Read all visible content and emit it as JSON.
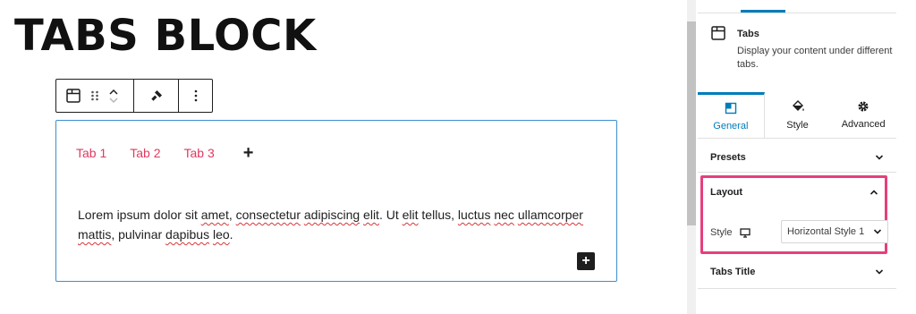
{
  "canvas": {
    "page_title": "TABS BLOCK",
    "toolbar": {
      "block_icon": "tabs-block-icon",
      "drag_icon": "drag-handle-icon",
      "move_up_icon": "chevron-up-icon",
      "move_down_icon": "chevron-down-icon",
      "style_icon": "paint-brush-icon",
      "more_icon": "more-options-icon"
    },
    "tabs_block": {
      "tabs": [
        {
          "label": "Tab 1"
        },
        {
          "label": "Tab 2"
        },
        {
          "label": "Tab 3"
        }
      ],
      "add_tab_label": "+",
      "content": {
        "t1": "Lorem ipsum dolor sit ",
        "w_amet": "amet",
        "t2": ", ",
        "w_consectetur": "consectetur",
        "t3": " ",
        "w_adipiscing": "adipiscing",
        "t4": " ",
        "w_elit1": "elit",
        "t5": ". Ut ",
        "w_elit2": "elit",
        "t6": " tellus, ",
        "w_luctus": "luctus",
        "t7": " ",
        "w_nec": "nec",
        "t8": " ",
        "w_ullamcorper": "ullamcorper",
        "t9": " ",
        "w_mattis": "mattis",
        "t10": ", pulvinar ",
        "w_dapibus": "dapibus",
        "t11": " ",
        "w_leo": "leo",
        "t12": "."
      },
      "inserter_label": "+"
    }
  },
  "sidebar": {
    "block_card": {
      "icon": "tabs-block-icon",
      "title": "Tabs",
      "description": "Display your content under different tabs."
    },
    "panel_tabs": [
      {
        "label": "General",
        "icon": "general-icon",
        "active": true
      },
      {
        "label": "Style",
        "icon": "paint-bucket-icon",
        "active": false
      },
      {
        "label": "Advanced",
        "icon": "gear-icon",
        "active": false
      }
    ],
    "presets": {
      "label": "Presets",
      "expanded": false
    },
    "layout": {
      "label": "Layout",
      "expanded": true,
      "style_label": "Style",
      "device_icon": "desktop-icon",
      "style_value": "Horizontal Style 1"
    },
    "tabs_title": {
      "label": "Tabs Title",
      "expanded": false
    }
  },
  "colors": {
    "accent_blue": "#007cba",
    "tab_label_pink": "#e0395f",
    "highlight_pink": "#e63f7c",
    "block_border_blue": "#3b8fd0"
  }
}
